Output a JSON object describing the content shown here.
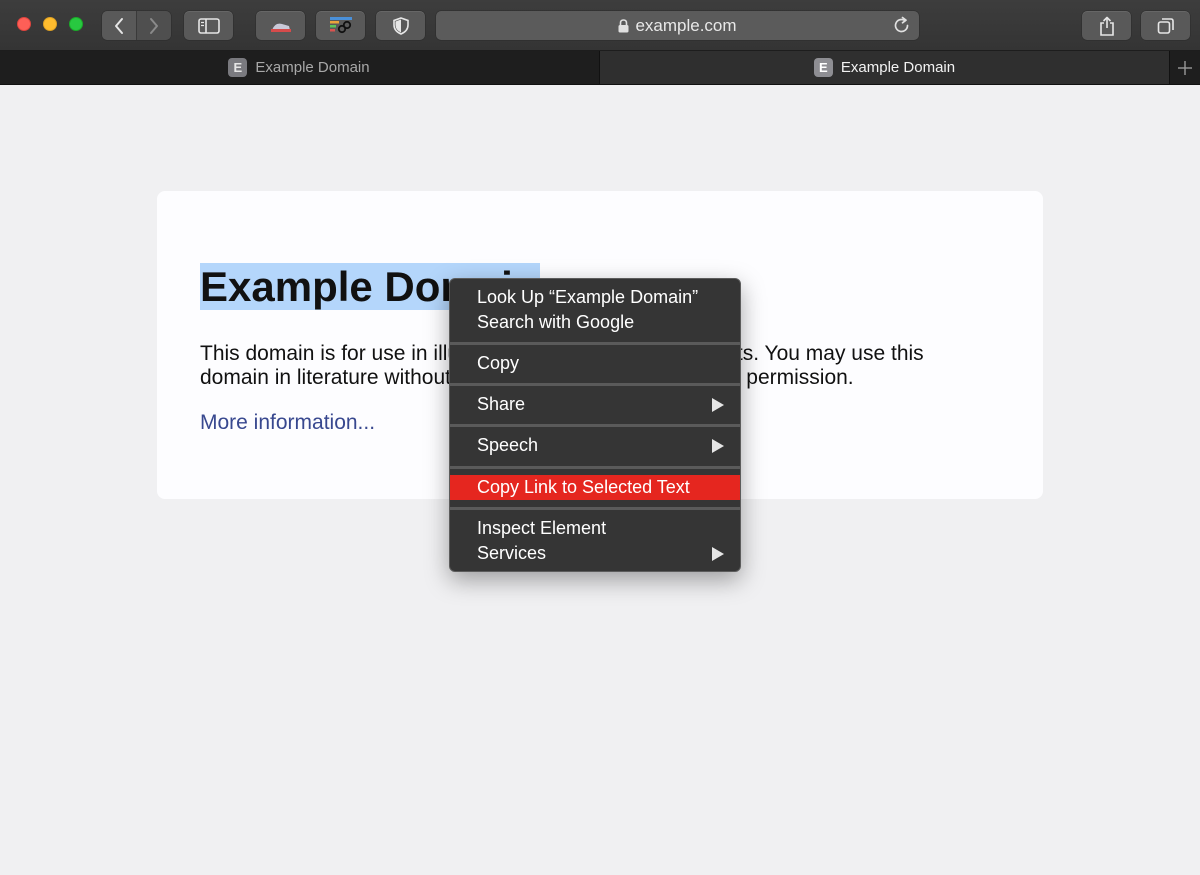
{
  "window": {
    "controls": [
      "close",
      "minimize",
      "zoom"
    ],
    "address_url": "example.com"
  },
  "toolbar": {
    "icons": {
      "back": "chevron-left-icon",
      "forward": "chevron-right-icon",
      "sidebar": "sidebar-icon",
      "extension_1": "extension-icon",
      "extension_2": "link-extension-icon",
      "privacy": "shield-icon",
      "lock": "lock-icon",
      "reload": "reload-icon",
      "share": "share-icon",
      "tabs": "tab-overview-icon"
    }
  },
  "tabs": [
    {
      "label": "Example Domain",
      "favicon_letter": "E",
      "active": false
    },
    {
      "label": "Example Domain",
      "favicon_letter": "E",
      "active": true
    }
  ],
  "page": {
    "title_selected": "Example Domain",
    "body_line_1": "This domain is for use in illustrative examples in documents. You may use this",
    "body_line_2": "domain in literature without prior coordination or asking for permission.",
    "more_link": "More information..."
  },
  "context_menu": {
    "items": [
      {
        "label": "Look Up “Example Domain”",
        "submenu": false
      },
      {
        "label": "Search with Google",
        "submenu": false
      },
      {
        "label": "Copy",
        "submenu": false
      },
      {
        "label": "Share",
        "submenu": true
      },
      {
        "label": "Speech",
        "submenu": true
      },
      {
        "label": "Copy Link to Selected Text",
        "submenu": false,
        "highlighted": true
      },
      {
        "label": "Inspect Element",
        "submenu": false
      },
      {
        "label": "Services",
        "submenu": true
      }
    ]
  },
  "colors": {
    "page_background": "#f0f0f2",
    "card_background": "#fdfdff",
    "selection": "#b4d6fb",
    "link": "#38488f",
    "menu_background": "#353535",
    "menu_highlight": "#e5261f"
  }
}
